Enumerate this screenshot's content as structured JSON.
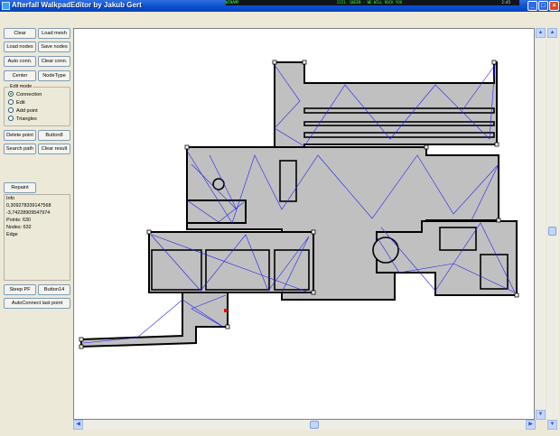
{
  "window": {
    "title": "Afterfall WalkpadEditor by Jakub Gert",
    "controls": {
      "minimize": "_",
      "maximize": "□",
      "close": "×"
    }
  },
  "winamp": {
    "label": "WINAMP",
    "track": "2151. QUEEN - WE WILL ROCK YOU",
    "time": "2:45"
  },
  "buttons": {
    "clear": "Clear",
    "load_mesh": "Load mesh",
    "load_nodes": "Load nodes",
    "save_nodes": "Save nodes",
    "auto_conn": "Auto conn.",
    "clear_conn": "Clear conn.",
    "center": "Center",
    "node_type": "NodeType",
    "delete_point": "Delete point",
    "button8": "Button8",
    "search_path": "Search path",
    "clear_result": "Clear result",
    "repaint": "Repaint",
    "steep_pf": "Steep PF",
    "button14": "Button14",
    "autoconnect_last_point": "AutoConnect last point"
  },
  "edit_mode": {
    "caption": "Edit mode",
    "options": [
      "Connection",
      "Edit",
      "Add point",
      "Triangles"
    ],
    "selected": 0
  },
  "info": {
    "caption": "Info",
    "lines": [
      "0,309278339147568",
      "-3,742289095479​74",
      "Points: 630",
      "Nodes: 632",
      "Edge"
    ]
  },
  "colors": {
    "wall_fill": "#c0c0c0",
    "wall_outline": "#000000",
    "connection": "#2222ee",
    "node": "#ffffff",
    "selected": "#ff0000"
  },
  "icons": {
    "scroll_up": "arrow-up-icon",
    "scroll_down": "arrow-down-icon",
    "scroll_left": "arrow-left-icon",
    "scroll_right": "arrow-right-icon"
  }
}
